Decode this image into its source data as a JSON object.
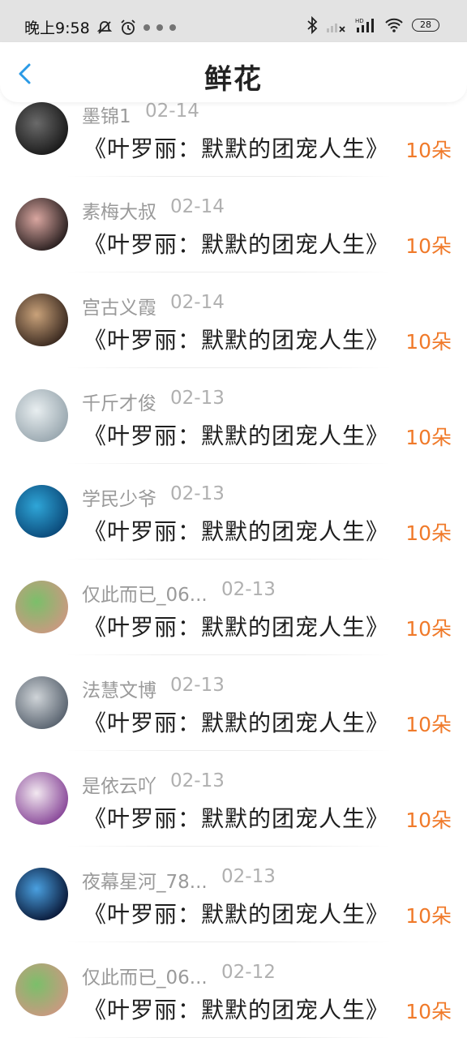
{
  "status_bar": {
    "time": "晚上9:58",
    "battery": "28"
  },
  "header": {
    "title": "鲜花"
  },
  "colors": {
    "accent": "#f07a2a",
    "back_arrow": "#2a9ae6"
  },
  "records": [
    {
      "name": "墨锦1",
      "date": "02-14",
      "book": "《叶罗丽：默默的团宠人生》",
      "count": "10朵",
      "avatar_colors": [
        "#1a1a1a",
        "#6a6a6a"
      ]
    },
    {
      "name": "素梅大叔",
      "date": "02-14",
      "book": "《叶罗丽：默默的团宠人生》",
      "count": "10朵",
      "avatar_colors": [
        "#2a2020",
        "#d9a6a0"
      ]
    },
    {
      "name": "宫古义霞",
      "date": "02-14",
      "book": "《叶罗丽：默默的团宠人生》",
      "count": "10朵",
      "avatar_colors": [
        "#3b2a20",
        "#c9a27a"
      ]
    },
    {
      "name": "千斤才俊",
      "date": "02-13",
      "book": "《叶罗丽：默默的团宠人生》",
      "count": "10朵",
      "avatar_colors": [
        "#9aa8b0",
        "#e8eef0"
      ]
    },
    {
      "name": "学民少爷",
      "date": "02-13",
      "book": "《叶罗丽：默默的团宠人生》",
      "count": "10朵",
      "avatar_colors": [
        "#0b4a7a",
        "#2fa6d8"
      ]
    },
    {
      "name": "仅此而已_06...",
      "date": "02-13",
      "book": "《叶罗丽：默默的团宠人生》",
      "count": "10朵",
      "avatar_colors": [
        "#c89a80",
        "#7bbf6a"
      ]
    },
    {
      "name": "法慧文博",
      "date": "02-13",
      "book": "《叶罗丽：默默的团宠人生》",
      "count": "10朵",
      "avatar_colors": [
        "#5a6470",
        "#cfd4d8"
      ]
    },
    {
      "name": "是依云吖",
      "date": "02-13",
      "book": "《叶罗丽：默默的团宠人生》",
      "count": "10朵",
      "avatar_colors": [
        "#8a4a9a",
        "#f2e8f0"
      ]
    },
    {
      "name": "夜幕星河_78...",
      "date": "02-13",
      "book": "《叶罗丽：默默的团宠人生》",
      "count": "10朵",
      "avatar_colors": [
        "#0a1a3a",
        "#4aa0e0"
      ]
    },
    {
      "name": "仅此而已_06...",
      "date": "02-12",
      "book": "《叶罗丽：默默的团宠人生》",
      "count": "10朵",
      "avatar_colors": [
        "#c89a80",
        "#7bbf6a"
      ]
    }
  ]
}
